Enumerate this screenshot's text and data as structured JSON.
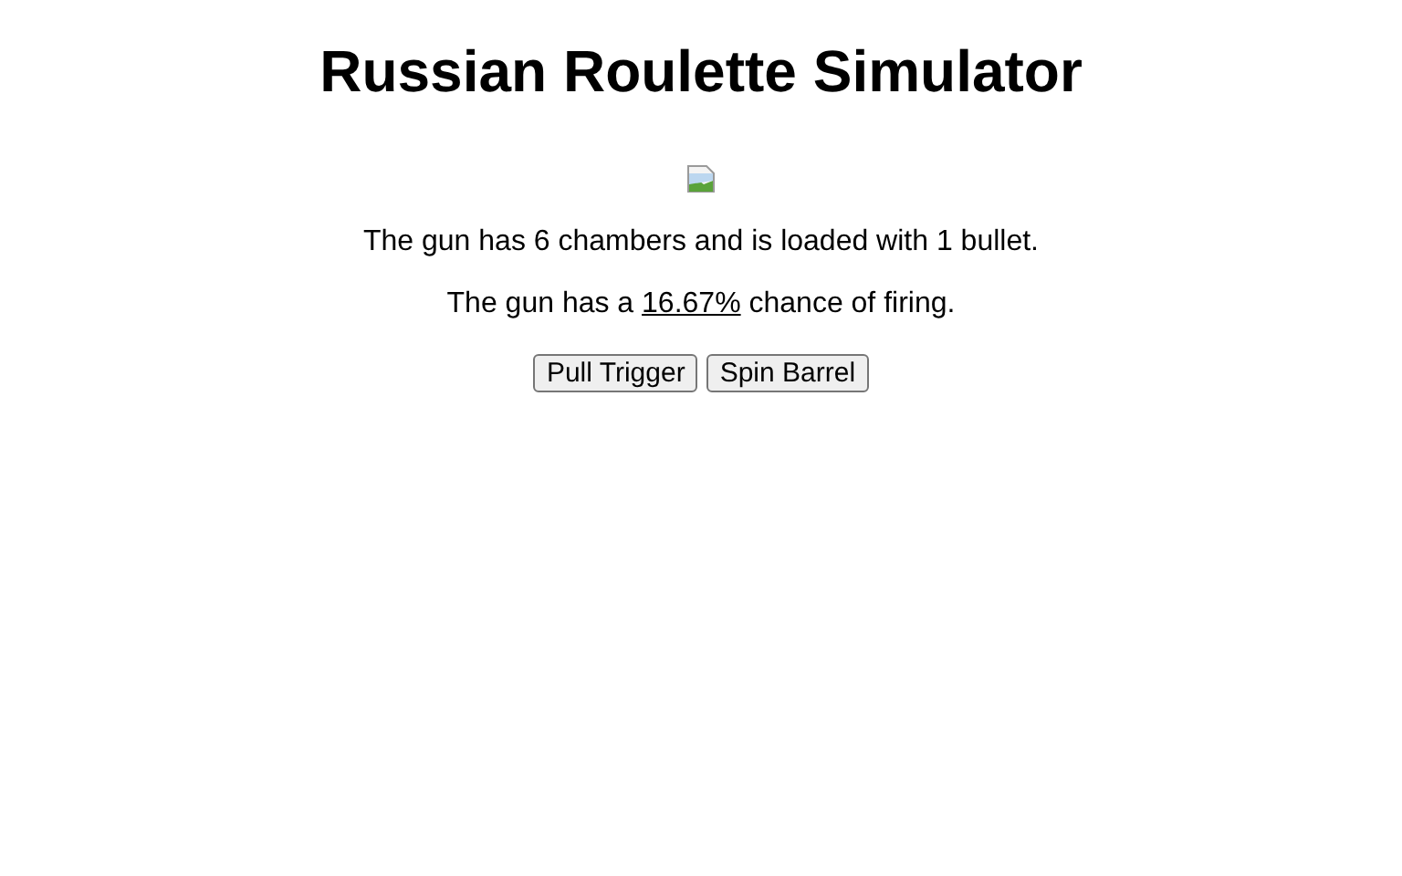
{
  "title": "Russian Roulette Simulator",
  "status": "The gun has 6 chambers and is loaded with 1 bullet.",
  "chance": {
    "prefix": "The gun has a ",
    "value": "16.67%",
    "suffix": " chance of firing."
  },
  "buttons": [
    "Pull Trigger",
    "Spin Barrel"
  ]
}
